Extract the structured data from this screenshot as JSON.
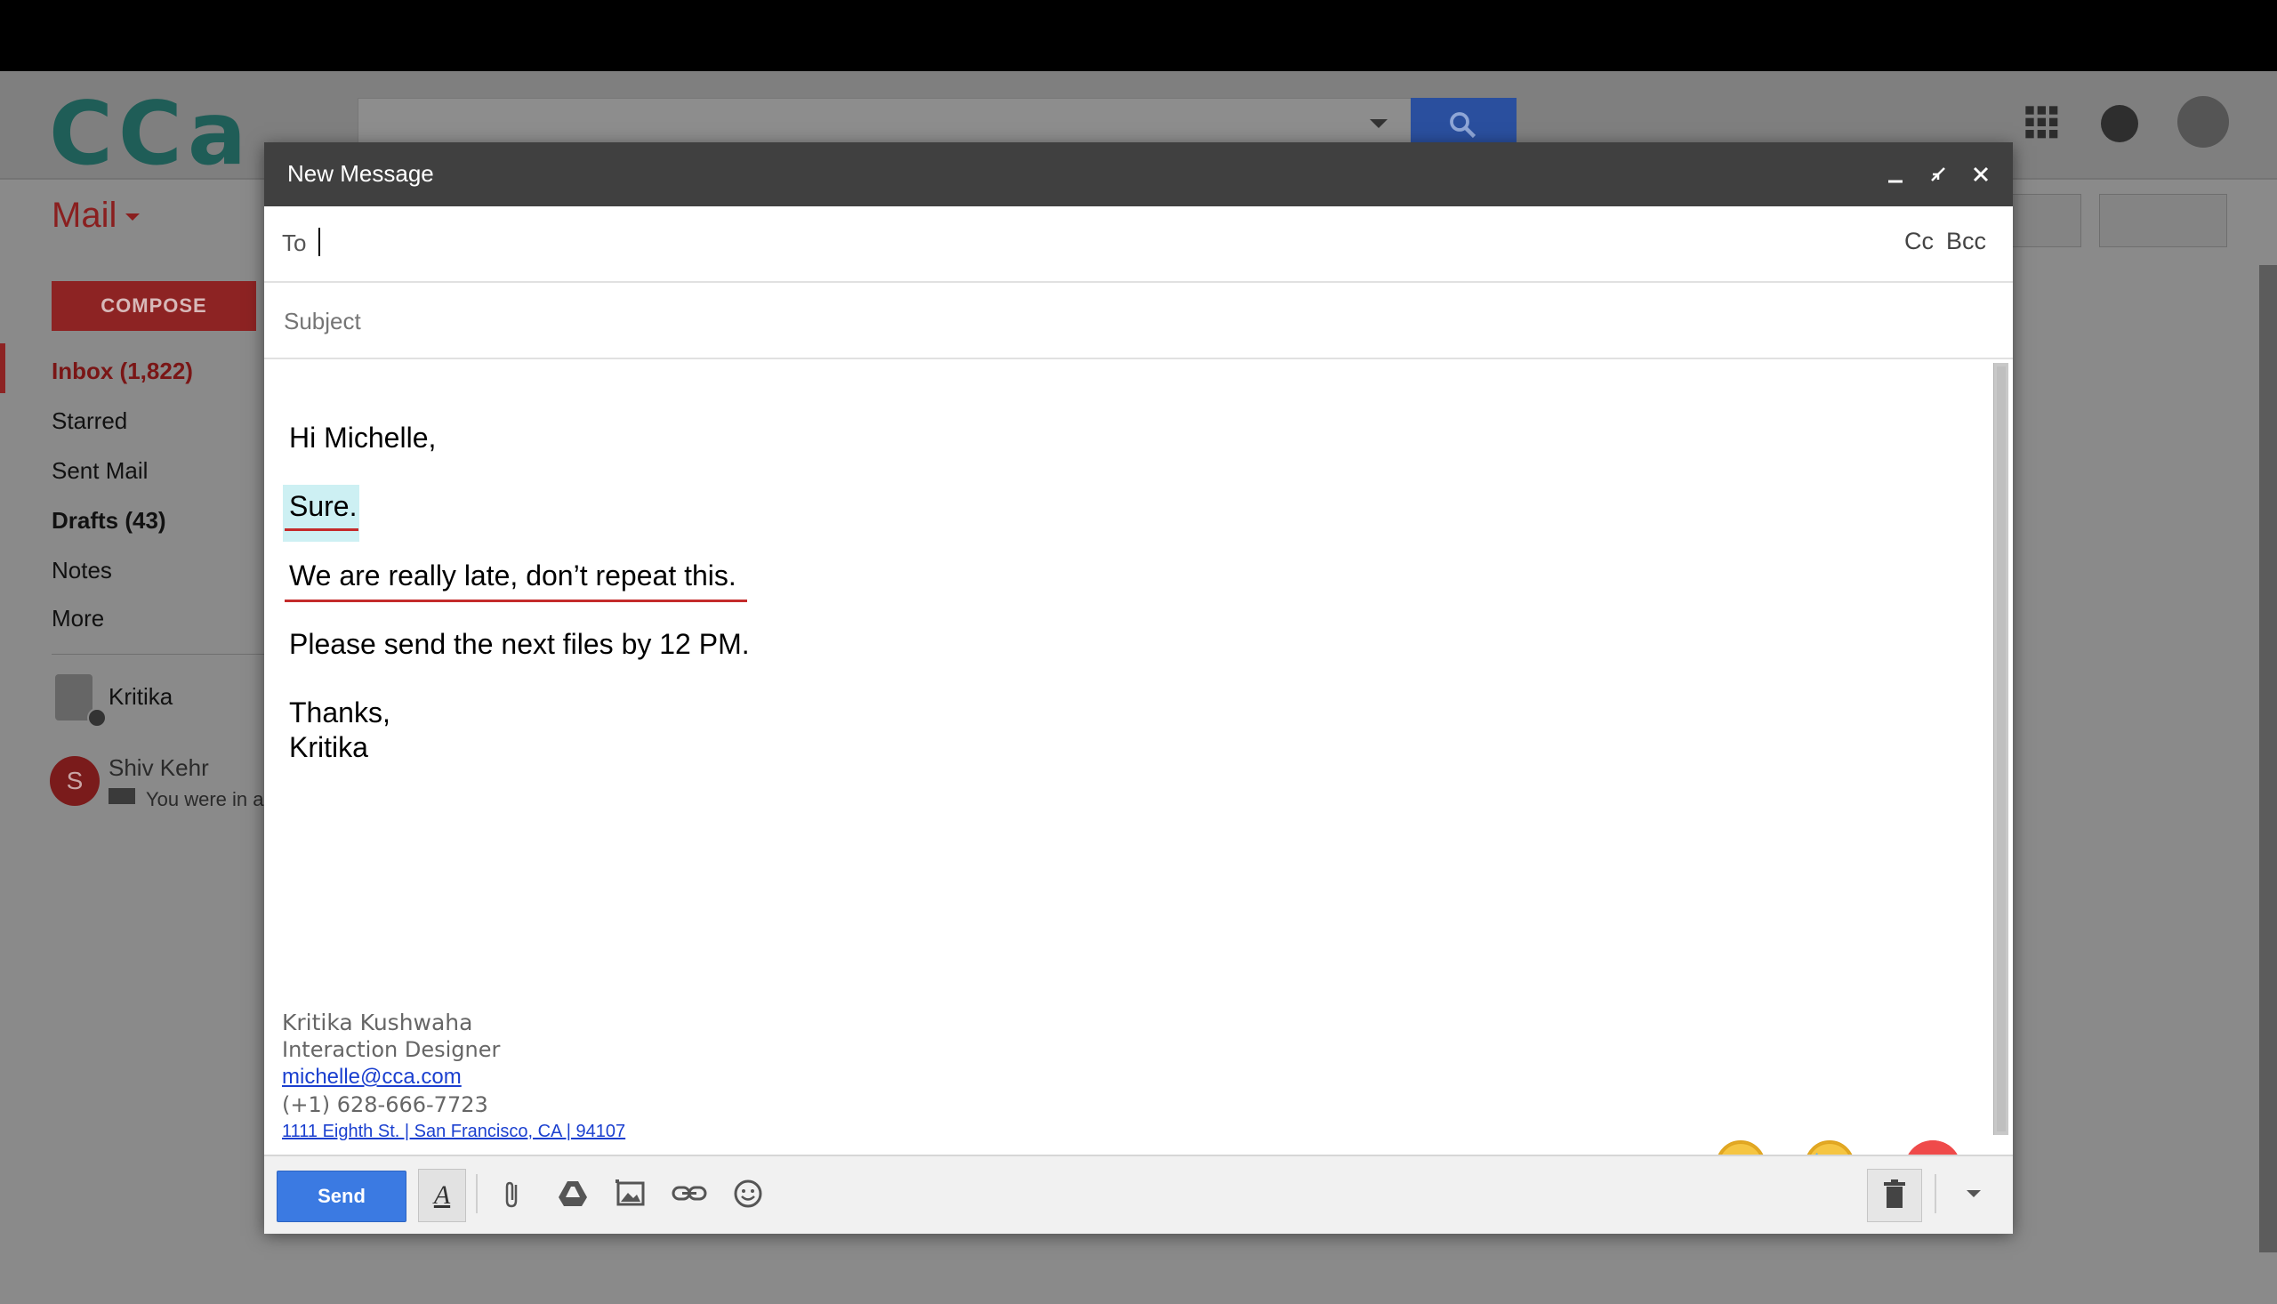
{
  "app": {
    "logo": "CCa",
    "mail_label": "Mail",
    "compose_label": "COMPOSE",
    "sidebar": [
      {
        "label": "Inbox (1,822)"
      },
      {
        "label": "Starred"
      },
      {
        "label": "Sent Mail"
      },
      {
        "label": "Drafts (43)"
      },
      {
        "label": "Notes"
      },
      {
        "label": "More"
      }
    ],
    "chat": {
      "me": "Kritika",
      "contact_name": "Shiv Kehr",
      "contact_initial": "S",
      "contact_status": "You were in a"
    }
  },
  "compose": {
    "title": "New Message",
    "to_label": "To",
    "to_value": "",
    "cc_label": "Cc",
    "bcc_label": "Bcc",
    "subject_placeholder": "Subject",
    "subject_value": "",
    "body": {
      "greeting": "Hi Michelle,",
      "line1": "Sure.",
      "line2": "We are really late, don’t repeat this.",
      "line3": "Please send the next files by 12 PM.",
      "closing": "Thanks,",
      "name": "Kritika"
    },
    "signature": {
      "name": "Kritika Kushwaha",
      "title": "Interaction Designer",
      "email": "michelle@cca.com",
      "phone": "(+1)  628-666-7723",
      "address": "1111 Eighth St. | San Francisco, CA | 94107"
    },
    "send_label": "Send",
    "format_label": "A"
  },
  "colors": {
    "send_blue": "#3b7ae2",
    "header_dark": "#404040",
    "highlight": "#cdf0f3",
    "underline_red": "#c42b2b",
    "close_red": "#ef4a4a"
  }
}
